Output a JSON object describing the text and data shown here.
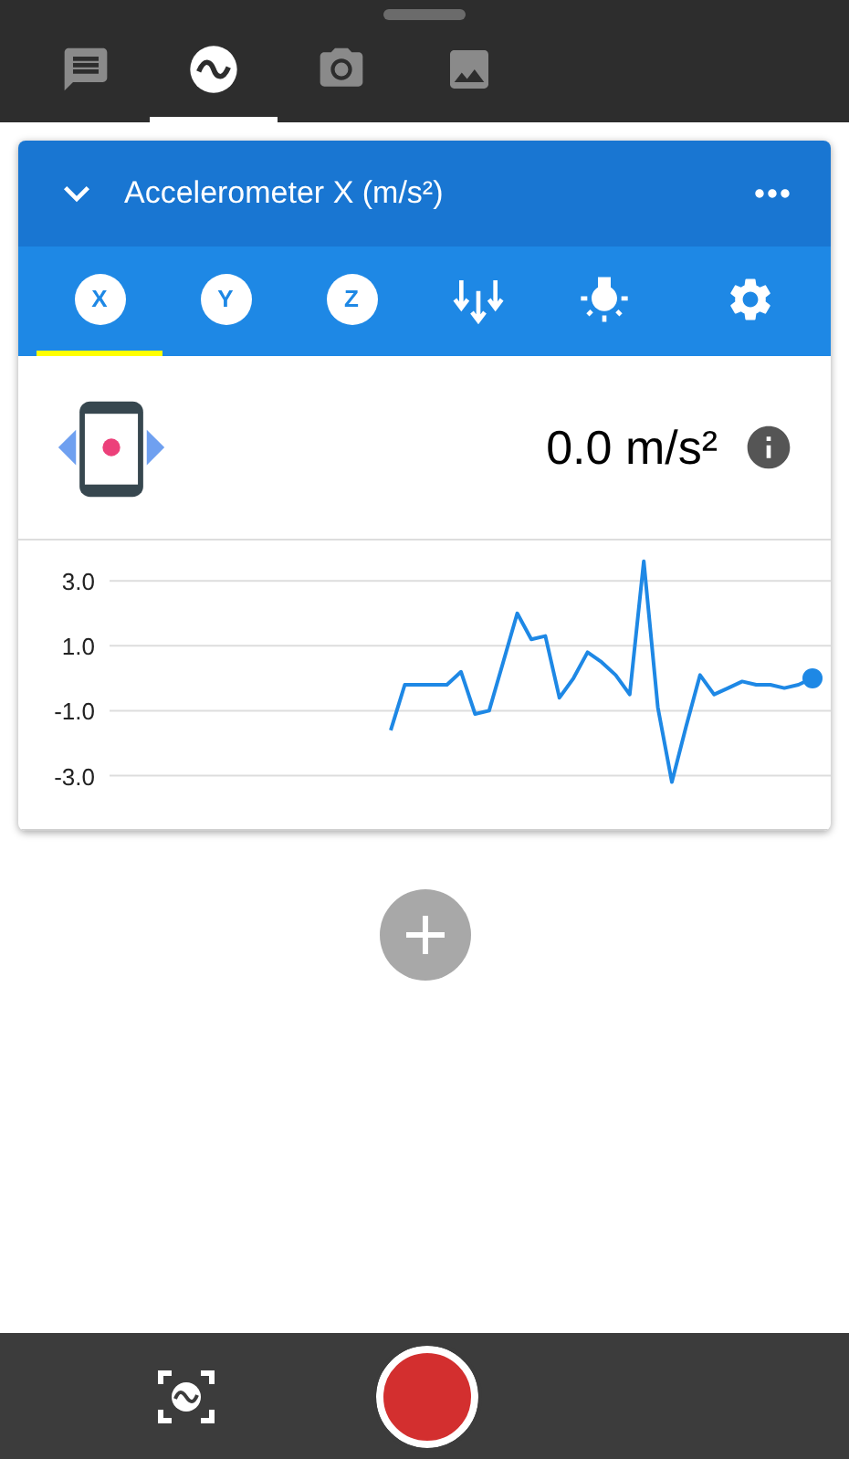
{
  "tabs": [
    {
      "kind": "notes",
      "selected": false
    },
    {
      "kind": "sensor",
      "selected": true
    },
    {
      "kind": "camera",
      "selected": false
    },
    {
      "kind": "gallery",
      "selected": false
    }
  ],
  "card": {
    "title": "Accelerometer X (m/s²)",
    "sensor_tabs": [
      {
        "kind": "x",
        "label": "X",
        "selected": true
      },
      {
        "kind": "y",
        "label": "Y",
        "selected": false
      },
      {
        "kind": "z",
        "label": "Z",
        "selected": false
      },
      {
        "kind": "magnitude",
        "selected": false
      },
      {
        "kind": "light",
        "selected": false
      },
      {
        "kind": "settings",
        "selected": false
      }
    ],
    "reading": "0.0 m/s²",
    "chart_data": {
      "type": "line",
      "grid": true,
      "ylim": [
        -4.7,
        4.3
      ],
      "yticks": [
        {
          "value": 3,
          "label": "3.0"
        },
        {
          "value": 1,
          "label": "1.0"
        },
        {
          "value": -1,
          "label": "-1.0"
        },
        {
          "value": -3,
          "label": "-3.0"
        }
      ],
      "categories": [
        null,
        null,
        null,
        null,
        null,
        null,
        null,
        null,
        null,
        null,
        null,
        null,
        null,
        null,
        null,
        null,
        null,
        null,
        null,
        null,
        null,
        null,
        null,
        null,
        null,
        null,
        null,
        null,
        null,
        null,
        null,
        null,
        null,
        null,
        null,
        null,
        null,
        null,
        null,
        null,
        null,
        null,
        null,
        null,
        null,
        null,
        null,
        null,
        null,
        null,
        null
      ],
      "series": [
        {
          "color": "#1e88e5",
          "values": [
            null,
            null,
            null,
            null,
            null,
            null,
            null,
            null,
            null,
            null,
            null,
            null,
            null,
            null,
            null,
            null,
            null,
            null,
            null,
            null,
            -1.6,
            -0.2,
            -0.2,
            -0.2,
            -0.2,
            0.2,
            -1.1,
            -1.0,
            0.5,
            2.0,
            1.2,
            1.3,
            -0.6,
            0.0,
            0.8,
            0.5,
            0.1,
            -0.5,
            3.6,
            -0.9,
            -3.2,
            -1.5,
            0.1,
            -0.5,
            -0.3,
            -0.1,
            -0.2,
            -0.2,
            -0.3,
            -0.2,
            0.0
          ]
        }
      ]
    }
  }
}
